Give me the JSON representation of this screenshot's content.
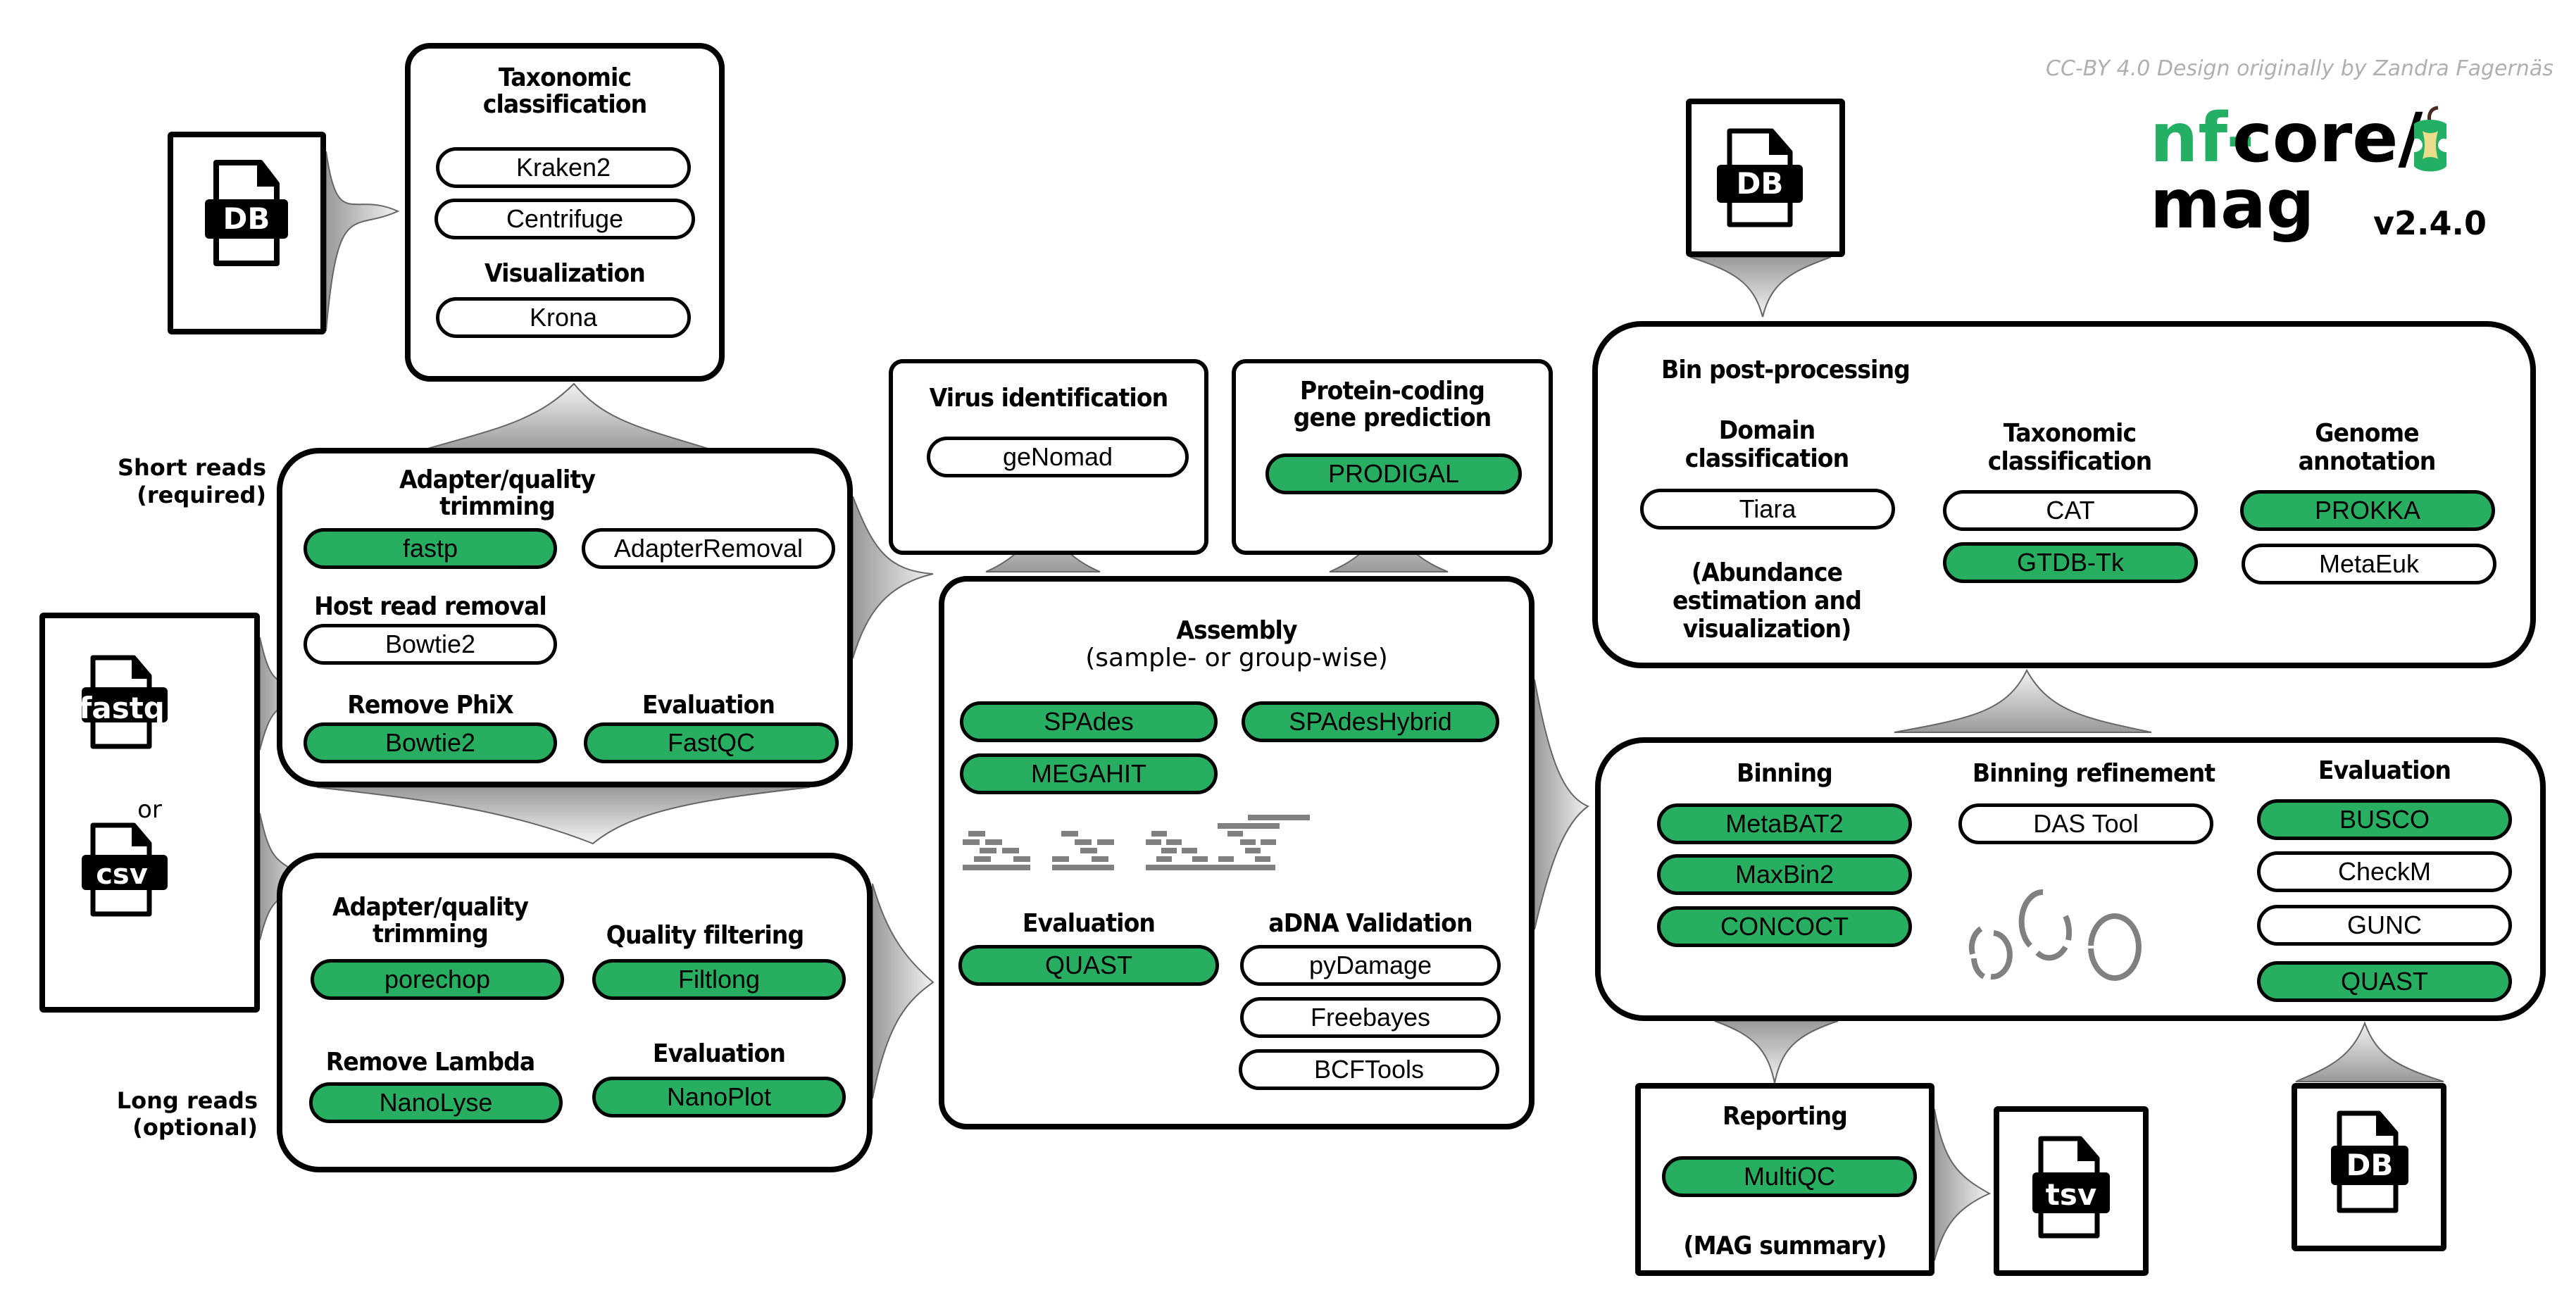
{
  "credit": "CC-BY 4.0 Design originally by Zandra Fagernäs",
  "logo": {
    "prefix": "nf-",
    "core": "core/",
    "name": "mag",
    "version": "v2.4.0",
    "icon": "apple-core-icon",
    "accent_color": "#24b064"
  },
  "colors": {
    "tool_default": "#27ae60",
    "tool_optional": "#ffffff",
    "connector_dark": "#999999",
    "connector_light": "#f2f2f2"
  },
  "inputs": {
    "fastq_label": "fastq",
    "or_label": "or",
    "csv_label": "csv",
    "short_reads_label_line1": "Short reads",
    "short_reads_label_line2": "(required)",
    "long_reads_label_line1": "Long reads",
    "long_reads_label_line2": "(optional)"
  },
  "databases": {
    "taxonomy_db_label": "DB",
    "bin_post_db_label": "DB",
    "evaluation_db_label": "DB"
  },
  "taxonomic_classification": {
    "title_line1": "Taxonomic",
    "title_line2": "classification",
    "tools": [
      {
        "label": "Kraken2",
        "default": false
      },
      {
        "label": "Centrifuge",
        "default": false
      }
    ],
    "visualization_title": "Visualization",
    "visualization_tools": [
      {
        "label": "Krona",
        "default": false
      }
    ]
  },
  "short_reads": {
    "trimming_title_line1": "Adapter/quality",
    "trimming_title_line2": "trimming",
    "trimming_tools": [
      {
        "label": "fastp",
        "default": true
      },
      {
        "label": "AdapterRemoval",
        "default": false
      }
    ],
    "host_removal_title": "Host read removal",
    "host_removal_tools": [
      {
        "label": "Bowtie2",
        "default": false
      }
    ],
    "phix_title": "Remove PhiX",
    "phix_tools": [
      {
        "label": "Bowtie2",
        "default": true
      }
    ],
    "evaluation_title": "Evaluation",
    "evaluation_tools": [
      {
        "label": "FastQC",
        "default": true
      }
    ]
  },
  "long_reads": {
    "trimming_title_line1": "Adapter/quality",
    "trimming_title_line2": "trimming",
    "trimming_tools": [
      {
        "label": "porechop",
        "default": true
      }
    ],
    "filtering_title": "Quality filtering",
    "filtering_tools": [
      {
        "label": "Filtlong",
        "default": true
      }
    ],
    "lambda_title": "Remove Lambda",
    "lambda_tools": [
      {
        "label": "NanoLyse",
        "default": true
      }
    ],
    "evaluation_title": "Evaluation",
    "evaluation_tools": [
      {
        "label": "NanoPlot",
        "default": true
      }
    ]
  },
  "virus_identification": {
    "title": "Virus identification",
    "tools": [
      {
        "label": "geNomad",
        "default": false
      }
    ]
  },
  "protein_prediction": {
    "title_line1": "Protein-coding",
    "title_line2": "gene prediction",
    "tools": [
      {
        "label": "PRODIGAL",
        "default": true
      }
    ]
  },
  "assembly": {
    "title": "Assembly",
    "subtitle": "(sample- or group-wise)",
    "tools": [
      {
        "label": "SPAdes",
        "default": true
      },
      {
        "label": "SPAdesHybrid",
        "default": true
      },
      {
        "label": "MEGAHIT",
        "default": true
      }
    ],
    "evaluation_title": "Evaluation",
    "evaluation_tools": [
      {
        "label": "QUAST",
        "default": true
      }
    ],
    "adna_title": "aDNA Validation",
    "adna_tools": [
      {
        "label": "pyDamage",
        "default": false
      },
      {
        "label": "Freebayes",
        "default": false
      },
      {
        "label": "BCFTools",
        "default": false
      }
    ]
  },
  "bin_post_processing": {
    "title": "Bin post-processing",
    "domain_title_line1": "Domain",
    "domain_title_line2": "classification",
    "domain_tools": [
      {
        "label": "Tiara",
        "default": false
      }
    ],
    "abundance_line1": "(Abundance",
    "abundance_line2": "estimation and",
    "abundance_line3": "visualization)",
    "taxonomy_title_line1": "Taxonomic",
    "taxonomy_title_line2": "classification",
    "taxonomy_tools": [
      {
        "label": "CAT",
        "default": false
      },
      {
        "label": "GTDB-Tk",
        "default": true
      }
    ],
    "annotation_title_line1": "Genome",
    "annotation_title_line2": "annotation",
    "annotation_tools": [
      {
        "label": "PROKKA",
        "default": true
      },
      {
        "label": "MetaEuk",
        "default": false
      }
    ]
  },
  "binning": {
    "binning_title": "Binning",
    "binning_tools": [
      {
        "label": "MetaBAT2",
        "default": true
      },
      {
        "label": "MaxBin2",
        "default": true
      },
      {
        "label": "CONCOCT",
        "default": true
      }
    ],
    "refinement_title": "Binning refinement",
    "refinement_tools": [
      {
        "label": "DAS Tool",
        "default": false
      }
    ],
    "evaluation_title": "Evaluation",
    "evaluation_tools": [
      {
        "label": "BUSCO",
        "default": true
      },
      {
        "label": "CheckM",
        "default": false
      },
      {
        "label": "GUNC",
        "default": false
      },
      {
        "label": "QUAST",
        "default": true
      }
    ]
  },
  "reporting": {
    "title": "Reporting",
    "tools": [
      {
        "label": "MultiQC",
        "default": true
      }
    ],
    "summary": "(MAG summary)",
    "output_label": "tsv"
  }
}
